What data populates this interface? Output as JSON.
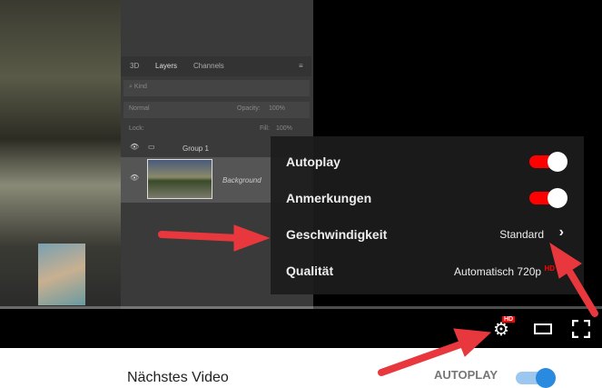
{
  "photoshop": {
    "tabs": [
      "3D",
      "Layers",
      "Channels"
    ],
    "kind": "Kind",
    "blend": "Normal",
    "opacity_label": "Opacity:",
    "opacity": "100%",
    "lock_label": "Lock:",
    "fill_label": "Fill:",
    "fill": "100%",
    "layers": [
      "Group 1",
      "Background"
    ]
  },
  "menu": {
    "items": [
      {
        "label": "Autoplay",
        "toggle": true
      },
      {
        "label": "Anmerkungen",
        "toggle": true
      },
      {
        "label": "Geschwindigkeit",
        "value": "Standard"
      },
      {
        "label": "Qualität",
        "value": "Automatisch 720p",
        "badge": "HD"
      }
    ]
  },
  "controls": {
    "settings_badge": "HD"
  },
  "below": {
    "next_video": "Nächstes Video",
    "autoplay_label": "AUTOPLAY",
    "autoplay_on": true
  },
  "colors": {
    "accent_red": "#ff0000",
    "arrow_red": "#e8383d",
    "toggle_blue": "#2a8ae0"
  }
}
